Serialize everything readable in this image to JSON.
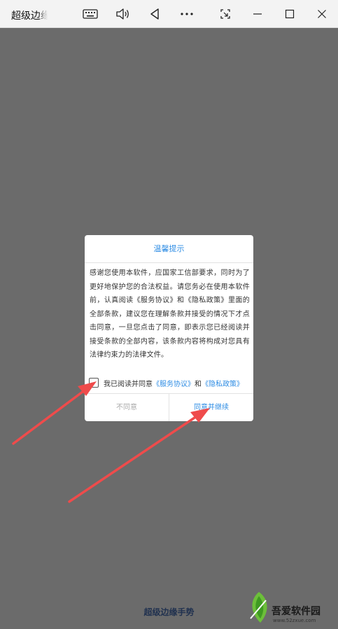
{
  "window": {
    "title": "超级边缘手势",
    "toolbar_icons": [
      "keyboard-icon",
      "volume-icon",
      "back-triangle-icon",
      "more-icon",
      "screenshot-icon",
      "minimize-icon",
      "maximize-icon",
      "close-icon"
    ]
  },
  "dialog": {
    "title": "温馨提示",
    "body": "感谢您使用本软件，应国家工信部要求，同时为了更好地保护您的合法权益。请您务必在使用本软件前，认真阅读《服务协议》和《隐私政策》里面的全部条款，建议您在理解条款并接受的情况下才点击同意，一旦您点击了同意，即表示您已经阅读并接受条款的全部内容，该条款内容将构成对您具有法律约束力的法律文件。",
    "agree_prefix": "我已阅读并同意",
    "service_link": "《服务协议》",
    "and_text": "和",
    "privacy_link": "《隐私政策》",
    "checkbox_checked": false,
    "disagree_label": "不同意",
    "agree_label": "同意并继续"
  },
  "bottom_brand": "超级边缘手势",
  "watermark": {
    "text": "吾爱软件园",
    "url": "www.52zxue.com"
  },
  "colors": {
    "accent": "#2f8de4",
    "screen_background": "#6b6b6b",
    "arrow": "#ef4b4b"
  }
}
